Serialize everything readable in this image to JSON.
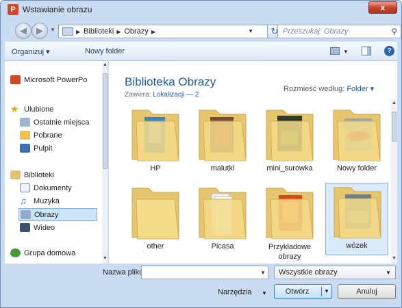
{
  "window": {
    "title": "Wstawianie obrazu",
    "close_label": "x",
    "app_icon": "P"
  },
  "address": {
    "crumbs": [
      "Biblioteki",
      "Obrazy"
    ]
  },
  "search": {
    "placeholder": "Przeszukaj: Obrazy"
  },
  "toolbar": {
    "organize_label": "Organizuj ▾",
    "new_folder_label": "Nowy folder",
    "help_label": "?"
  },
  "navpane": {
    "items": [
      {
        "label": "Microsoft PowerPo",
        "icon": "powerpoint-icon"
      },
      {
        "label": "Ulubione",
        "icon": "star-icon"
      },
      {
        "label": "Ostatnie miejsca",
        "icon": "recent-places-icon"
      },
      {
        "label": "Pobrane",
        "icon": "downloads-icon"
      },
      {
        "label": "Pulpit",
        "icon": "desktop-icon"
      },
      {
        "label": "Biblioteki",
        "icon": "libraries-icon"
      },
      {
        "label": "Dokumenty",
        "icon": "documents-icon"
      },
      {
        "label": "Muzyka",
        "icon": "music-icon"
      },
      {
        "label": "Obrazy",
        "icon": "pictures-icon",
        "selected": true
      },
      {
        "label": "Wideo",
        "icon": "video-icon"
      },
      {
        "label": "Grupa domowa",
        "icon": "homegroup-icon"
      }
    ]
  },
  "content": {
    "library_title": "Biblioteka Obrazy",
    "includes_label": "Zawiera:",
    "includes_link": "Lokalizacji — 2",
    "arrange_label": "Rozmieść według:",
    "arrange_value": "Folder ▾",
    "folders": [
      {
        "name": "HP"
      },
      {
        "name": "malutki"
      },
      {
        "name": "mini_surowka"
      },
      {
        "name": "Nowy folder"
      },
      {
        "name": "other"
      },
      {
        "name": "Picasa"
      },
      {
        "name": "Przykładowe obrazy"
      },
      {
        "name": "wózek",
        "selected": true
      }
    ]
  },
  "footer": {
    "filename_label": "Nazwa pliku:",
    "filename_value": "",
    "filter_value": "Wszystkie obrazy",
    "tools_label": "Narzędzia",
    "open_label": "Otwórz",
    "cancel_label": "Anuluj"
  },
  "colors": {
    "accent": "#1f5aa5",
    "selection": "#d9ebfa",
    "frame": "#c9dcf1"
  }
}
